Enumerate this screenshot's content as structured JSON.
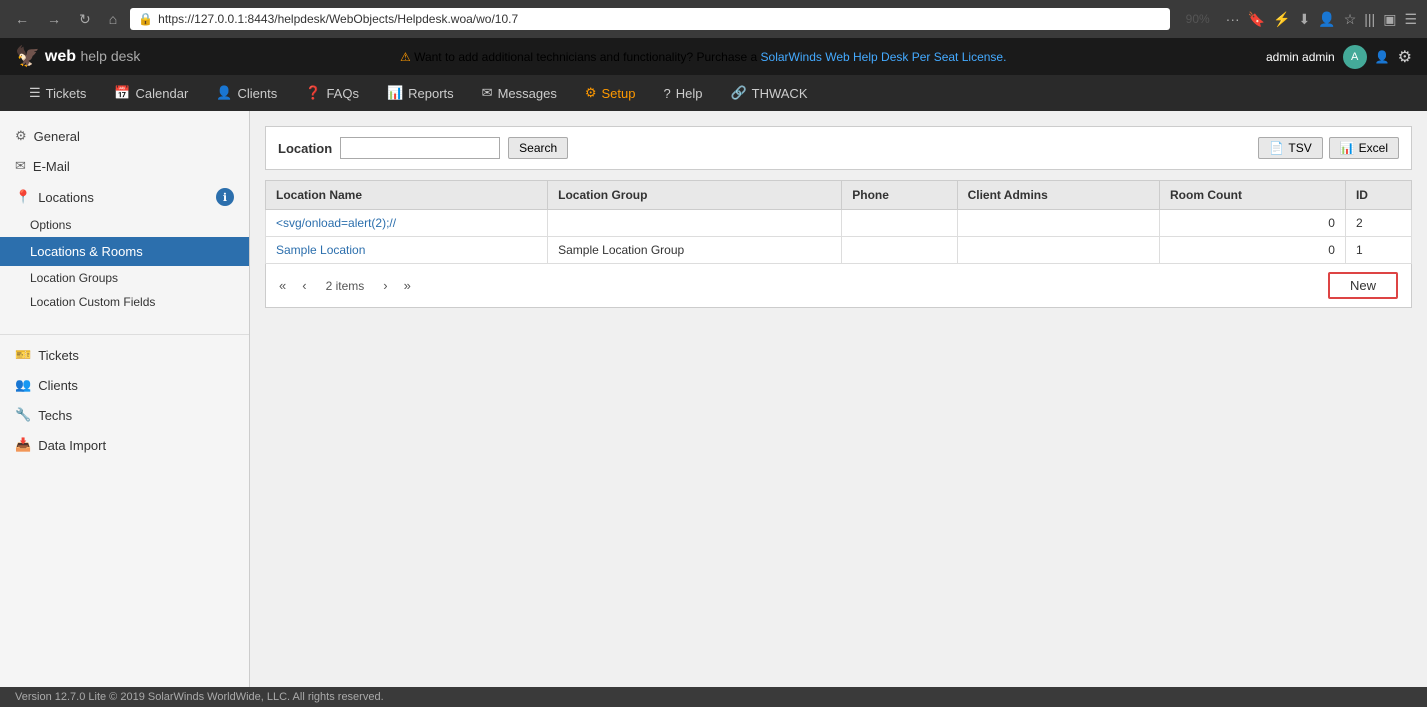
{
  "browser": {
    "url": "https://127.0.0.1:8443/helpdesk/WebObjects/Helpdesk.woa/wo/10.7",
    "zoom": "90%"
  },
  "app": {
    "logo": "web help desk",
    "banner_text": "Want to add additional technicians and functionality? Purchase a",
    "banner_link": "SolarWinds Web Help Desk Per Seat License.",
    "admin_label": "admin admin"
  },
  "nav": {
    "items": [
      {
        "label": "Tickets",
        "icon": "☰"
      },
      {
        "label": "Calendar",
        "icon": "📅"
      },
      {
        "label": "Clients",
        "icon": "👤"
      },
      {
        "label": "FAQs",
        "icon": "❓"
      },
      {
        "label": "Reports",
        "icon": "📊"
      },
      {
        "label": "Messages",
        "icon": "✉"
      },
      {
        "label": "Setup",
        "icon": "⚙",
        "active": true
      },
      {
        "label": "Help",
        "icon": "?"
      },
      {
        "label": "THWACK",
        "icon": "🔗"
      }
    ]
  },
  "sidebar": {
    "items": [
      {
        "label": "General",
        "icon": "⚙"
      },
      {
        "label": "E-Mail",
        "icon": "✉"
      },
      {
        "label": "Locations",
        "icon": "📍",
        "badge": "ℹ"
      }
    ],
    "sub_items": [
      {
        "label": "Options"
      },
      {
        "label": "Locations & Rooms",
        "active": true
      },
      {
        "label": "Location Groups"
      },
      {
        "label": "Location Custom Fields"
      }
    ],
    "bottom_items": [
      {
        "label": "Tickets",
        "icon": "🎫"
      },
      {
        "label": "Clients",
        "icon": "👥"
      },
      {
        "label": "Techs",
        "icon": "🔧"
      },
      {
        "label": "Data Import",
        "icon": "📥"
      }
    ]
  },
  "content": {
    "search_label": "Location",
    "search_placeholder": "",
    "search_btn": "Search",
    "tsv_btn": "TSV",
    "excel_btn": "Excel",
    "table": {
      "columns": [
        "Location Name",
        "Location Group",
        "Phone",
        "Client Admins",
        "Room Count",
        "ID"
      ],
      "rows": [
        {
          "name": "<svg/onload=alert(2);//",
          "group": "",
          "phone": "",
          "client_admins": "",
          "room_count": "0",
          "id": "2"
        },
        {
          "name": "Sample Location",
          "group": "Sample Location Group",
          "phone": "",
          "client_admins": "",
          "room_count": "0",
          "id": "1"
        }
      ]
    },
    "pagination": {
      "items_count": "2 items"
    },
    "new_btn": "New"
  },
  "footer": {
    "text": "Version 12.7.0 Lite © 2019 SolarWinds WorldWide, LLC. All rights reserved."
  }
}
